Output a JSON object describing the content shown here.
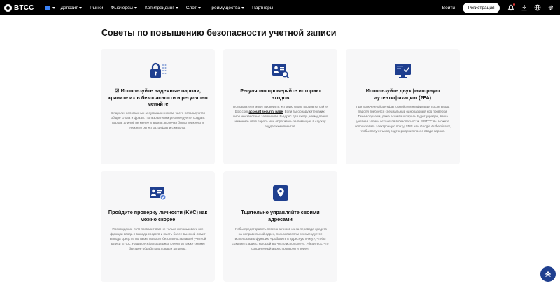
{
  "brand": {
    "logo_text": "BTCC"
  },
  "nav": {
    "menu": [
      {
        "label": "Депозит",
        "has_caret": true
      },
      {
        "label": "Рынки",
        "has_caret": false
      },
      {
        "label": "Фьючерсы",
        "has_caret": true
      },
      {
        "label": "Копитрейдинг",
        "has_caret": true
      },
      {
        "label": "Слот",
        "has_caret": true
      },
      {
        "label": "Преимущества",
        "has_caret": true
      },
      {
        "label": "Партнеры",
        "has_caret": false
      }
    ],
    "login_label": "Войти",
    "register_label": "Регистрация",
    "icons": [
      "apps-icon",
      "bell-icon",
      "download-icon",
      "globe-icon",
      "settings-icon"
    ]
  },
  "page": {
    "title": "Советы по повышению безопасности учетной записи"
  },
  "cards": [
    {
      "icon": "lock-keypad-icon",
      "title_check": "☑",
      "title": "Используйте надежные пароли, храните их в безопасности и регулярно меняйте",
      "desc": "В пароли, взломанных злоумышленником, часто используются общие слова и фразы. Пользователям рекомендуется создать пароль длиной не менее 8 знаков, включая буквы верхнего и нижнего регистра, цифры и символы."
    },
    {
      "icon": "user-card-search-icon",
      "title": "Регулярно проверяйте историю входов",
      "desc_before": "Пользователи могут проверить историю своих входов на сайте btcc.com",
      "desc_link": "account security page",
      "desc_after": ". Если вы обнаружите каких-либо неизвестные записи или IP-адрес для входа, немедленно измените свой пароль или обратитесь за помощью в службу поддержки клиентов."
    },
    {
      "icon": "monitor-check-icon",
      "title": "Используйте двухфакторную аутентификацию (2FA)",
      "desc": "При включенной двухфакторной аутентификации после ввода пароля требуется специальный одноразовый код проверки. Таким образом, даже если ваш пароль будет украден, ваша учетная запись останется в безопасности. В BTCC вы можете использовать электронную почту, SMS или Google Authenticator, чтобы получить код подтверждения после ввода пароля."
    },
    {
      "icon": "id-card-check-icon",
      "title": "Пройдите проверку личности (KYC) как можно скорее",
      "desc": "Прохождение KYC позволит вам не только использовать все функции ввода и вывода средств и иметь более высокий лимит вывода средств, но также повысит безопасность вашей учетной записи BTCC. Наша служба поддержки клиентов также сможет быстрее обрабатывать ваши запросы."
    },
    {
      "icon": "location-pin-icon",
      "title": "Тщательно управляйте своими адресами",
      "desc": "Чтобы предотвратить потерю активов из-за перевода средств на неправильный адрес, пользователям рекомендуется использовать функцию «Добавить в адресную книгу», чтобы сохранить адрес, который вы часто используете. Убедитесь, что сохраненный адрес проверен и верен."
    }
  ],
  "fab": {
    "icon": "scroll-top-icon"
  },
  "colors": {
    "accent": "#1f3f8f",
    "nav_bg": "#000000",
    "card_bg": "#f7f7f8",
    "muted_text": "#6b6b6b"
  }
}
